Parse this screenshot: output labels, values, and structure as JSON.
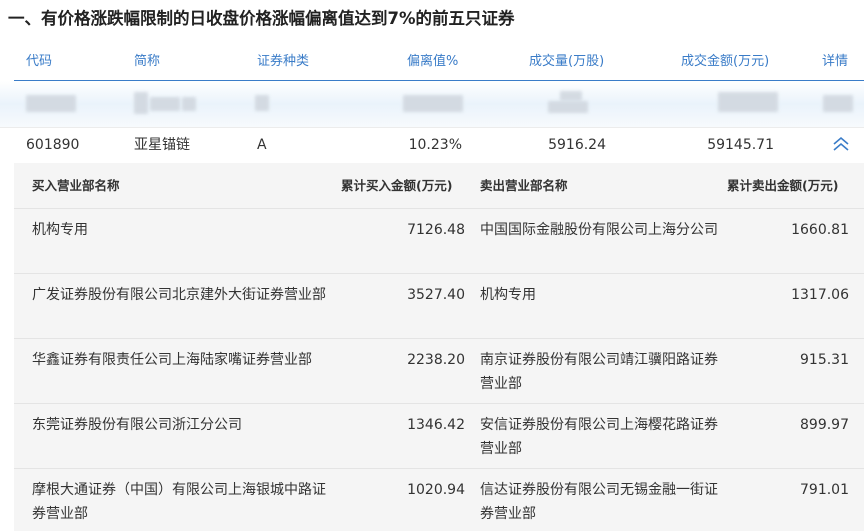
{
  "title": "一、有价格涨跌幅限制的日收盘价格涨幅偏离值达到7%的前五只证券",
  "columns": {
    "code": "代码",
    "name": "简称",
    "type": "证券种类",
    "deviation": "偏离值%",
    "volume": "成交量(万股)",
    "amount": "成交金额(万元)",
    "detail": "详情"
  },
  "stock": {
    "code": "601890",
    "name": "亚星锚链",
    "type": "A",
    "deviation": "10.23%",
    "volume": "5916.24",
    "amount": "59145.71",
    "toggle_icon": "chevron-double-up-icon"
  },
  "detail": {
    "buy_header": "买入营业部名称",
    "buy_amount_header": "累计买入金额(万元)",
    "sell_header": "卖出营业部名称",
    "sell_amount_header": "累计卖出金额(万元)",
    "rows": [
      {
        "buy_name": "机构专用",
        "buy_amount": "7126.48",
        "sell_name": "中国国际金融股份有限公司上海分公司",
        "sell_amount": "1660.81"
      },
      {
        "buy_name": "广发证券股份有限公司北京建外大街证券营业部",
        "buy_amount": "3527.40",
        "sell_name": "机构专用",
        "sell_amount": "1317.06"
      },
      {
        "buy_name": "华鑫证券有限责任公司上海陆家嘴证券营业部",
        "buy_amount": "2238.20",
        "sell_name": "南京证券股份有限公司靖江骥阳路证券营业部",
        "sell_amount": "915.31"
      },
      {
        "buy_name": "东莞证券股份有限公司浙江分公司",
        "buy_amount": "1346.42",
        "sell_name": "安信证券股份有限公司上海樱花路证券营业部",
        "sell_amount": "899.97"
      },
      {
        "buy_name": "摩根大通证券（中国）有限公司上海银城中路证券营业部",
        "buy_amount": "1020.94",
        "sell_name": "信达证券股份有限公司无锡金融一街证券营业部",
        "sell_amount": "791.01"
      }
    ]
  },
  "colors": {
    "header_blue": "#3a7cc8",
    "detail_background": "#f5f5f5"
  }
}
